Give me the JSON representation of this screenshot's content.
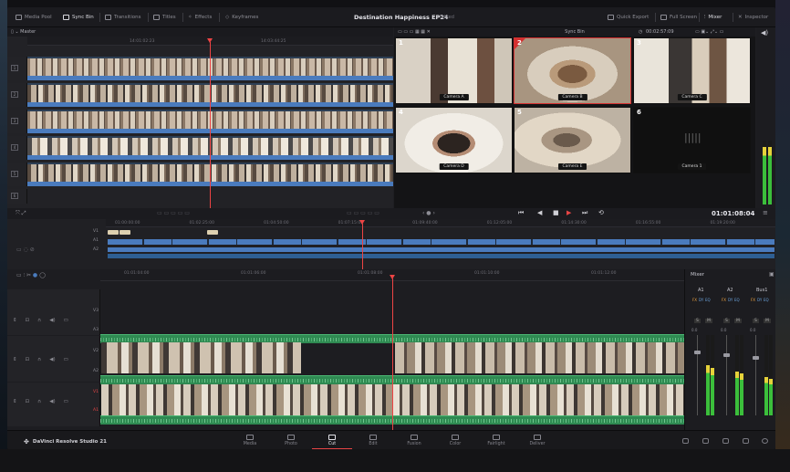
{
  "toolbar": {
    "media_pool": "Media Pool",
    "sync_bin": "Sync Bin",
    "transitions": "Transitions",
    "titles": "Titles",
    "effects": "Effects",
    "keyframes": "Keyframes",
    "quick_export": "Quick Export",
    "full_screen": "Full Screen",
    "mixer": "Mixer",
    "inspector": "Inspector"
  },
  "project": {
    "title": "Destination Happiness EP24",
    "status": "Edited"
  },
  "source_panel": {
    "label": "Master",
    "timecodes": [
      "14:01:02:23",
      "14:03:44:25"
    ],
    "track_labels": [
      "1",
      "2",
      "3",
      "4",
      "5",
      "6"
    ]
  },
  "sync_bin": {
    "title": "Sync Bin",
    "timecode": "00:02:57:09",
    "cameras": [
      {
        "num": "1",
        "label": "Camera A",
        "selected": false
      },
      {
        "num": "2",
        "label": "Camera B",
        "selected": true
      },
      {
        "num": "3",
        "label": "Camera C",
        "selected": false
      },
      {
        "num": "4",
        "label": "Camera D",
        "selected": false
      },
      {
        "num": "5",
        "label": "Camera E",
        "selected": false
      },
      {
        "num": "6",
        "label": "Camera 1",
        "selected": false
      }
    ]
  },
  "transport": {
    "timecode": "01:01:08:04"
  },
  "upper_timeline": {
    "timecodes": [
      "01:00:00:00",
      "01:02:25:00",
      "01:04:50:00",
      "01:07:15:00",
      "01:09:40:00",
      "01:12:05:00",
      "01:14:30:00",
      "01:16:55:00",
      "01:19:20:00"
    ],
    "lanes": [
      "V1",
      "A1",
      "A2"
    ]
  },
  "lower_timeline": {
    "timecodes": [
      "01:01:04:00",
      "01:01:06:00",
      "01:01:08:00",
      "01:01:10:00",
      "01:01:12:00"
    ],
    "tracks": [
      "V3",
      "A3",
      "V2",
      "A2",
      "V1",
      "A1"
    ]
  },
  "mixer": {
    "title": "Mixer",
    "channels": [
      "A1",
      "A2",
      "Bus1"
    ],
    "fx_labels": [
      "FX",
      "DY",
      "EQ"
    ],
    "solo": "S",
    "mute": "M",
    "db_values": [
      "0.0",
      "0.0",
      "0.0"
    ],
    "levels": [
      0.62,
      0.55,
      0.48
    ]
  },
  "pages": [
    {
      "label": "Media",
      "active": false
    },
    {
      "label": "Photo",
      "active": false
    },
    {
      "label": "Cut",
      "active": true
    },
    {
      "label": "Edit",
      "active": false
    },
    {
      "label": "Fusion",
      "active": false
    },
    {
      "label": "Color",
      "active": false
    },
    {
      "label": "Fairlight",
      "active": false
    },
    {
      "label": "Deliver",
      "active": false
    }
  ],
  "brand": "DaVinci Resolve Studio 21",
  "colors": {
    "accent": "#e84545",
    "video_clip_blue": "#4a7bbd",
    "audio_green": "#2f8a52"
  }
}
